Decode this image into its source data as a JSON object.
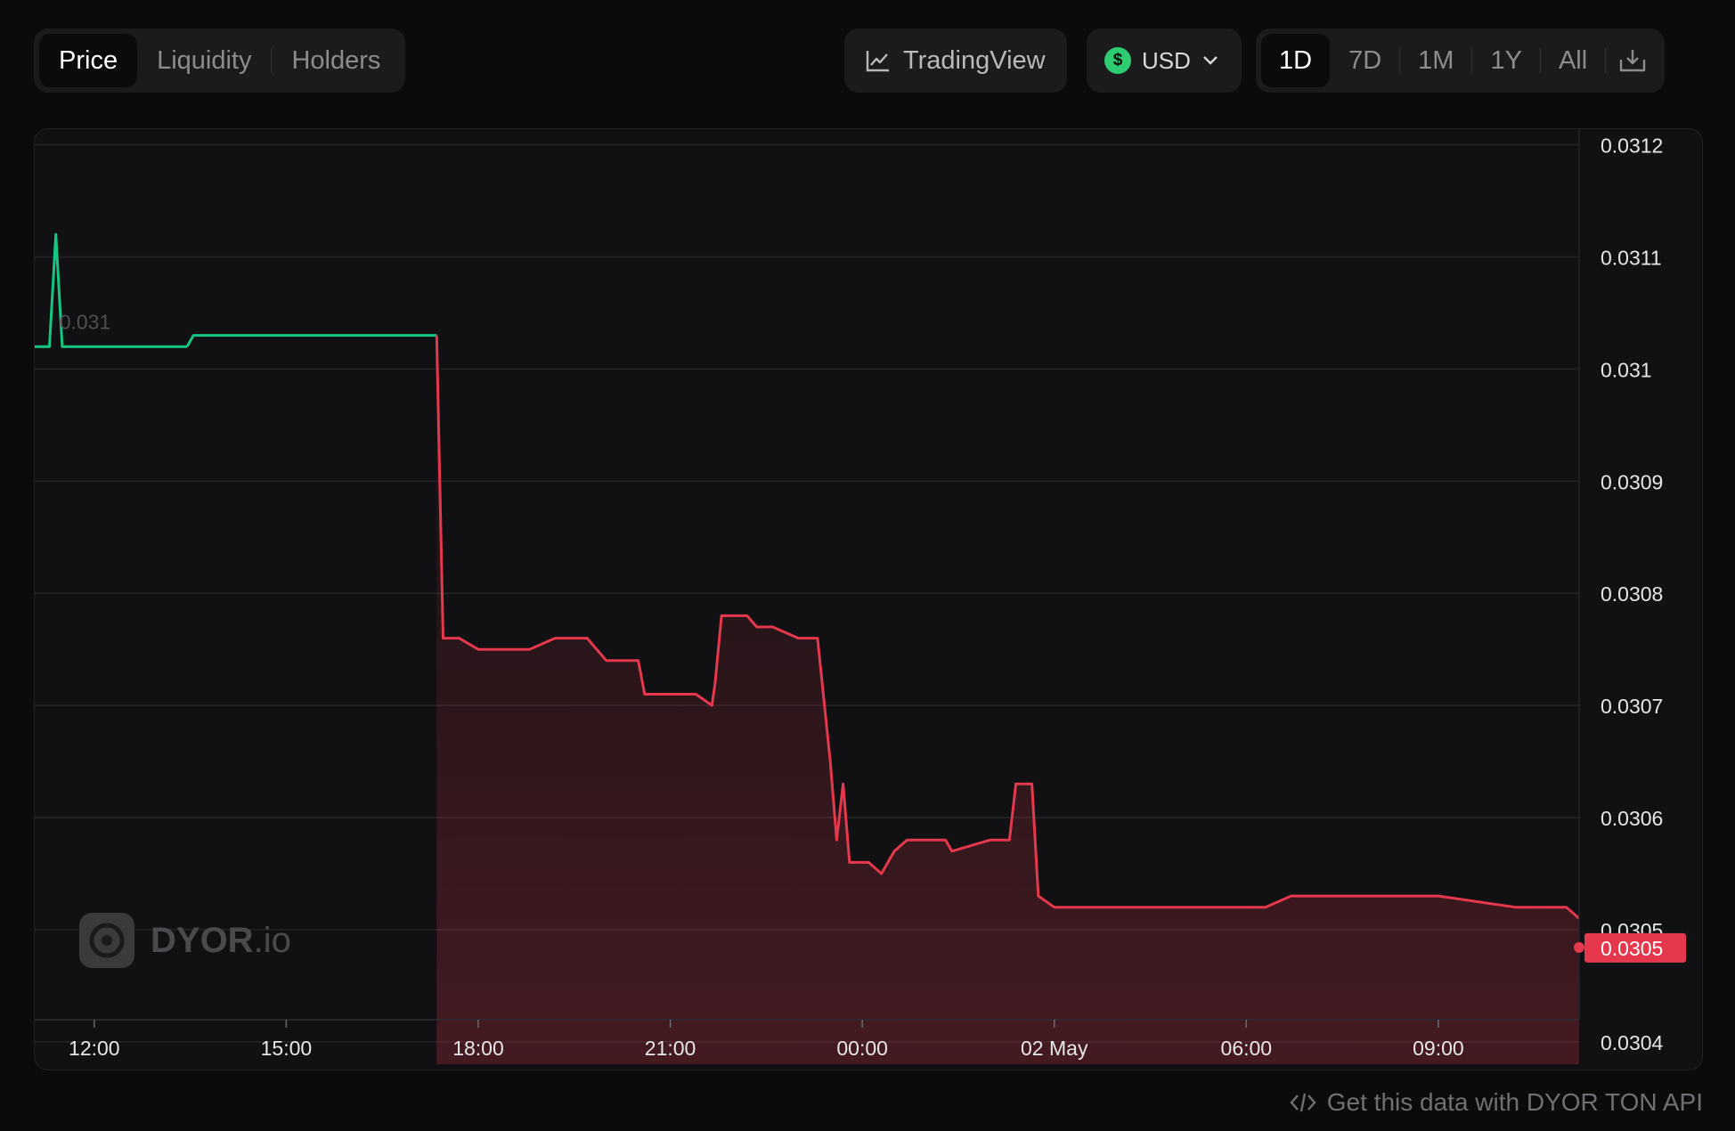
{
  "tabs": [
    {
      "label": "Price",
      "active": true
    },
    {
      "label": "Liquidity",
      "active": false
    },
    {
      "label": "Holders",
      "active": false
    }
  ],
  "toolbar": {
    "tradingview_label": "TradingView",
    "currency": {
      "label": "USD",
      "icon": "dollar-coin-icon",
      "color": "#2ecc71"
    },
    "ranges": [
      {
        "label": "1D",
        "active": true
      },
      {
        "label": "7D",
        "active": false
      },
      {
        "label": "1M",
        "active": false
      },
      {
        "label": "1Y",
        "active": false
      },
      {
        "label": "All",
        "active": false
      }
    ],
    "download_icon": "download-icon"
  },
  "watermark": {
    "brand": "DYOR",
    "suffix": ".io"
  },
  "current_price": {
    "value": "0.0305",
    "color": "#e5384d"
  },
  "colors": {
    "up": "#16c784",
    "down": "#e5384d"
  },
  "footer": {
    "label": "Get this data with DYOR TON API",
    "icon": "code-icon"
  },
  "chart_data": {
    "type": "line",
    "y_tick_labels": [
      "0.0312",
      "0.0311",
      "0.031",
      "0.0309",
      "0.0308",
      "0.0307",
      "0.0306",
      "0.0305",
      "0.0304"
    ],
    "ylim": [
      0.03038,
      0.03121
    ],
    "x_tick_labels": [
      "12:00",
      "15:00",
      "18:00",
      "21:00",
      "00:00",
      "02 May",
      "06:00",
      "09:00"
    ],
    "x_tick_hours": [
      0,
      3,
      6,
      9,
      12,
      15,
      18,
      21
    ],
    "xlim_hours": [
      -0.93,
      23.2
    ],
    "annotation": {
      "text": "0.031",
      "x": -0.6
    },
    "series": [
      {
        "color": "up",
        "points": [
          [
            -0.93,
            0.03102
          ],
          [
            -0.7,
            0.03102
          ],
          [
            -0.6,
            0.03112
          ],
          [
            -0.5,
            0.03102
          ],
          [
            0.0,
            0.03102
          ],
          [
            1.3,
            0.03102
          ],
          [
            1.45,
            0.03102
          ]
        ]
      },
      {
        "color": "up",
        "points": [
          [
            1.45,
            0.03102
          ],
          [
            1.55,
            0.03103
          ],
          [
            2.5,
            0.03103
          ],
          [
            3.5,
            0.03103
          ],
          [
            4.3,
            0.03103
          ],
          [
            5.2,
            0.03103
          ],
          [
            5.35,
            0.03103
          ]
        ]
      },
      {
        "color": "down",
        "points": [
          [
            5.35,
            0.03103
          ],
          [
            5.45,
            0.03076
          ],
          [
            5.7,
            0.03076
          ],
          [
            6.0,
            0.03075
          ],
          [
            6.8,
            0.03075
          ],
          [
            7.2,
            0.03076
          ],
          [
            7.7,
            0.03076
          ],
          [
            8.0,
            0.03074
          ],
          [
            8.3,
            0.03074
          ],
          [
            8.5,
            0.03074
          ],
          [
            8.6,
            0.03071
          ],
          [
            9.0,
            0.03071
          ],
          [
            9.4,
            0.03071
          ],
          [
            9.65,
            0.0307
          ],
          [
            9.7,
            0.03072
          ],
          [
            9.8,
            0.03078
          ],
          [
            10.2,
            0.03078
          ],
          [
            10.35,
            0.03077
          ],
          [
            10.6,
            0.03077
          ],
          [
            11.0,
            0.03076
          ],
          [
            11.3,
            0.03076
          ],
          [
            11.5,
            0.03065
          ],
          [
            11.6,
            0.03058
          ],
          [
            11.7,
            0.03063
          ],
          [
            11.8,
            0.03056
          ],
          [
            12.1,
            0.03056
          ],
          [
            12.3,
            0.03055
          ],
          [
            12.5,
            0.03057
          ],
          [
            12.7,
            0.03058
          ],
          [
            13.0,
            0.03058
          ],
          [
            13.3,
            0.03058
          ],
          [
            13.4,
            0.03057
          ],
          [
            14.0,
            0.03058
          ],
          [
            14.3,
            0.03058
          ],
          [
            14.4,
            0.03063
          ],
          [
            14.65,
            0.03063
          ],
          [
            14.75,
            0.03053
          ],
          [
            15.0,
            0.03052
          ],
          [
            15.3,
            0.03052
          ],
          [
            15.6,
            0.03052
          ],
          [
            16.2,
            0.03052
          ],
          [
            17.0,
            0.03052
          ],
          [
            18.3,
            0.03052
          ],
          [
            18.7,
            0.03053
          ],
          [
            19.5,
            0.03053
          ],
          [
            20.3,
            0.03053
          ],
          [
            21.0,
            0.03053
          ],
          [
            22.2,
            0.03052
          ],
          [
            23.0,
            0.03052
          ],
          [
            23.2,
            0.03051
          ]
        ]
      }
    ]
  }
}
